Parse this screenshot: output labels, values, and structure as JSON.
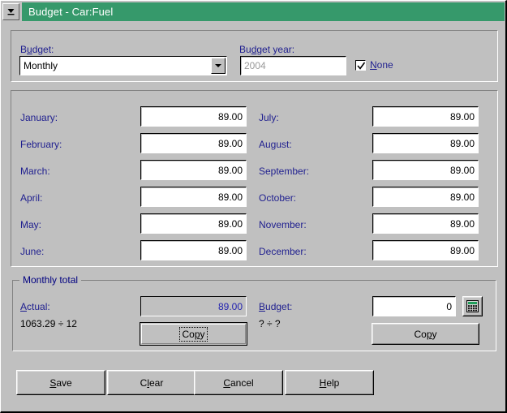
{
  "window": {
    "title": "Budget - Car:Fuel",
    "sysmenu_icon": "window-menu-icon"
  },
  "top_panel": {
    "budget_label": "Budget:",
    "budget_label_accel": "u",
    "budget_value": "Monthly",
    "budget_year_label": "Budget year:",
    "budget_year_accel": "d",
    "budget_year_value": "2004",
    "budget_year_disabled": true,
    "none_checkbox_label": "None",
    "none_checkbox_accel": "N",
    "none_checked": true,
    "dropdown_icon": "chevron-down-icon"
  },
  "months": {
    "left": [
      {
        "label": "January:",
        "value": "89.00"
      },
      {
        "label": "February:",
        "value": "89.00"
      },
      {
        "label": "March:",
        "value": "89.00"
      },
      {
        "label": "April:",
        "value": "89.00"
      },
      {
        "label": "May:",
        "value": "89.00"
      },
      {
        "label": "June:",
        "value": "89.00"
      }
    ],
    "right": [
      {
        "label": "July:",
        "value": "89.00"
      },
      {
        "label": "August:",
        "value": "89.00"
      },
      {
        "label": "September:",
        "value": "89.00"
      },
      {
        "label": "October:",
        "value": "89.00"
      },
      {
        "label": "November:",
        "value": "89.00"
      },
      {
        "label": "December:",
        "value": "89.00"
      }
    ]
  },
  "monthly_total": {
    "group_label": "Monthly total",
    "actual_label": "Actual:",
    "actual_accel": "A",
    "actual_value": "89.00",
    "actual_formula": "1063.29 ÷ 12",
    "actual_copy_label": "Copy",
    "actual_copy_accel": "p",
    "budget_label": "Budget:",
    "budget_accel": "B",
    "budget_value": "0",
    "budget_formula": "? ÷ ?",
    "budget_copy_label": "Copy",
    "budget_copy_accel": "p",
    "calculator_icon": "calculator-icon"
  },
  "footer_buttons": [
    {
      "label": "Save",
      "pre": "S",
      "mid": "ave",
      "post": ""
    },
    {
      "label": "Clear",
      "pre": "C",
      "mid": "l",
      "post": "ear"
    },
    {
      "label": "Cancel",
      "pre": "",
      "mid": "C",
      "post": "ancel"
    },
    {
      "label": "Help",
      "pre": "",
      "mid": "H",
      "post": "elp"
    }
  ],
  "colors": {
    "titlebar": "#36996b",
    "face": "#c0c0c0",
    "label_blue": "#1f1f8f",
    "readonly_text": "#2222b0",
    "group_label": "#000080"
  }
}
